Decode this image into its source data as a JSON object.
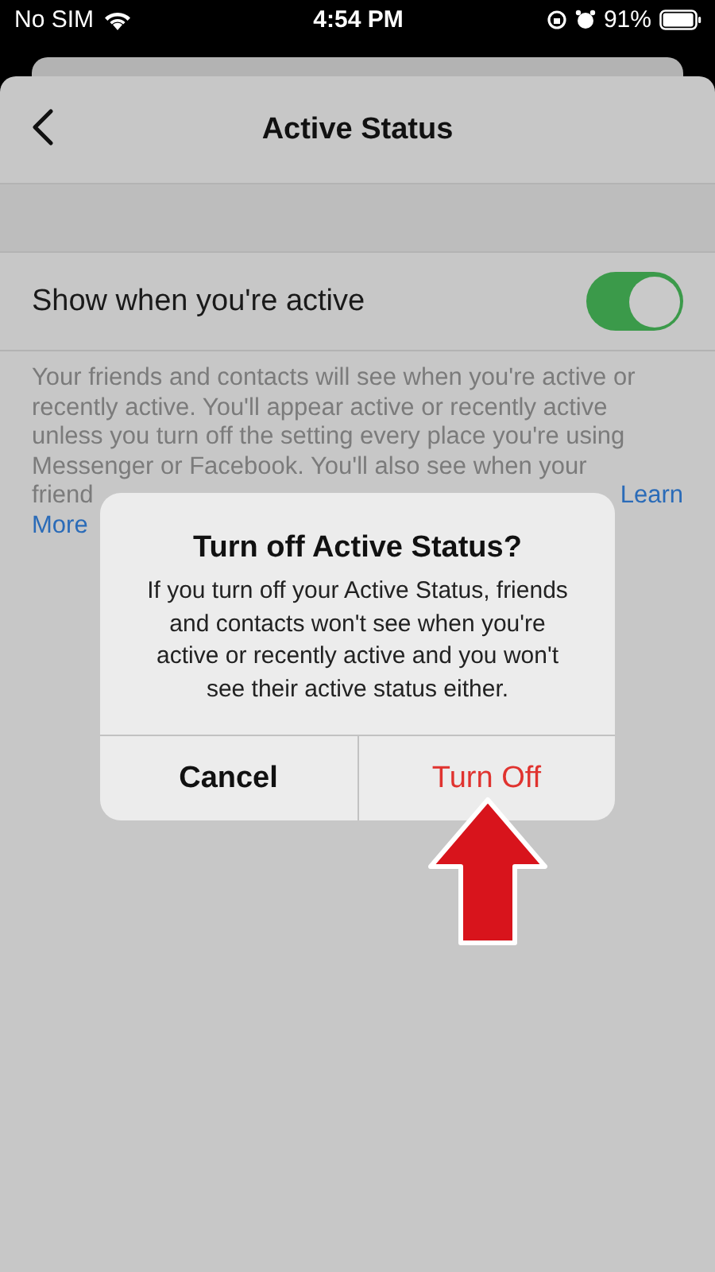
{
  "status_bar": {
    "carrier": "No SIM",
    "time": "4:54 PM",
    "battery": "91%"
  },
  "header": {
    "title": "Active Status"
  },
  "setting": {
    "label": "Show when you're active",
    "on": true
  },
  "description": {
    "lines": [
      "Your friends and contacts will see when you're active or recently active. You'll appear active or recently active unless you turn off the setting every place you're using Messenger or Facebook. You'll also see when your"
    ],
    "cut_start": "friend",
    "link_parts": [
      "Learn",
      "More"
    ]
  },
  "dialog": {
    "title": "Turn off Active Status?",
    "message": "If you turn off your Active Status, friends and contacts won't see when you're active or recently active and you won't see their active status either.",
    "buttons": [
      {
        "label": "Cancel",
        "kind": "cancel"
      },
      {
        "label": "Turn Off",
        "kind": "destructive"
      }
    ]
  },
  "annotation": {
    "kind": "arrow"
  }
}
